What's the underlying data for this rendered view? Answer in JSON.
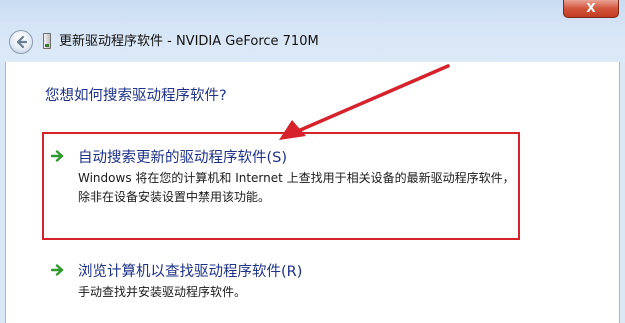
{
  "window": {
    "title": "更新驱动程序软件 - NVIDIA GeForce 710M",
    "close_label": "X"
  },
  "question": "您想如何搜索驱动程序软件?",
  "options": [
    {
      "title": "自动搜索更新的驱动程序软件(S)",
      "description": "Windows 将在您的计算机和 Internet 上查找用于相关设备的最新驱动程序软件，除非在设备安装设置中禁用该功能。"
    },
    {
      "title": "浏览计算机以查找驱动程序软件(R)",
      "description": "手动查找并安装驱动程序软件。"
    }
  ],
  "colors": {
    "link_blue": "#1e3287",
    "option_arrow_green": "#2f9b2f",
    "annotation_red": "#d6222a"
  },
  "icons": [
    "back-arrow-icon",
    "driver-device-icon",
    "green-arrow-icon",
    "annotation-arrow"
  ]
}
